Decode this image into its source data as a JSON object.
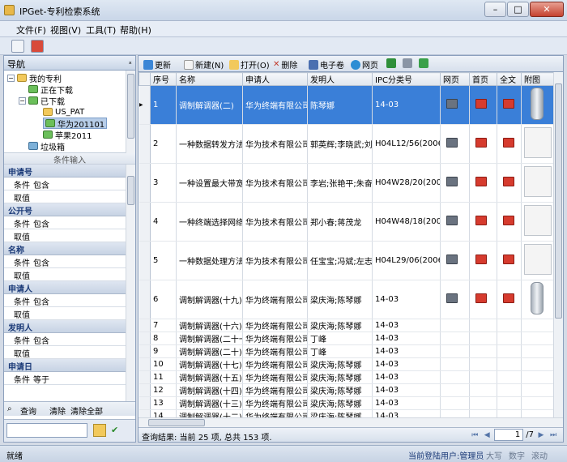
{
  "window": {
    "title": "IPGet-专利检索系统",
    "min": "–",
    "max": "□",
    "close": "✕"
  },
  "menu": [
    "文件(F)",
    "视图(V)",
    "工具(T)",
    "帮助(H)"
  ],
  "nav": {
    "title": "导航",
    "pin": "ₓ",
    "tree": [
      {
        "label": "我的专利"
      },
      {
        "label": "正在下载"
      },
      {
        "label": "已下载"
      },
      {
        "label": "US_PAT"
      },
      {
        "label": "华为201101"
      },
      {
        "label": "苹果2011"
      },
      {
        "label": "垃圾箱"
      }
    ],
    "cond_title": "条件输入",
    "sections": [
      {
        "name": "申请号",
        "cond_label": "条件",
        "cond": "包含",
        "val_label": "取值",
        "val": ""
      },
      {
        "name": "公开号",
        "cond_label": "条件",
        "cond": "包含",
        "val_label": "取值",
        "val": ""
      },
      {
        "name": "名称",
        "cond_label": "条件",
        "cond": "包含",
        "val_label": "取值",
        "val": ""
      },
      {
        "name": "申请人",
        "cond_label": "条件",
        "cond": "包含",
        "val_label": "取值",
        "val": ""
      },
      {
        "name": "发明人",
        "cond_label": "条件",
        "cond": "包含",
        "val_label": "取值",
        "val": ""
      },
      {
        "name": "申请日",
        "cond_label": "条件",
        "cond": "等于",
        "val_label": "",
        "val": ""
      }
    ],
    "query": "查询",
    "clear": "清除",
    "clear_all": "清除全部"
  },
  "toolbar": {
    "refresh": "更新",
    "new": "新建(N)",
    "open": "打开(O)",
    "delete": "删除",
    "ebook": "电子卷",
    "web": "网页"
  },
  "columns": [
    "序号",
    "名称",
    "申请人",
    "发明人",
    "IPC分类号",
    "网页",
    "首页",
    "全文",
    "附图"
  ],
  "rows": [
    {
      "no": "1",
      "name": "调制解调器(二)",
      "applicant": "华为终端有限公司",
      "inventor": "陈琴娜",
      "ipc": "14-03",
      "size": "big",
      "sel": true,
      "img": "cyl"
    },
    {
      "no": "2",
      "name": "一种数据转发方法",
      "applicant": "华为技术有限公司",
      "inventor": "郭英辉;李晓武;刘火",
      "ipc": "H04L12/56(2006",
      "size": "big",
      "img": "doc"
    },
    {
      "no": "3",
      "name": "一种设置最大带宽",
      "applicant": "华为技术有限公司",
      "inventor": "李岩;张艳平;朱奋勇",
      "ipc": "H04W28/20(200",
      "size": "big",
      "img": "doc"
    },
    {
      "no": "4",
      "name": "一种终端选择网络",
      "applicant": "华为技术有限公司",
      "inventor": "郑小春;蒋茂龙",
      "ipc": "H04W48/18(200",
      "size": "big",
      "img": "doc"
    },
    {
      "no": "5",
      "name": "一种数据处理方法",
      "applicant": "华为技术有限公司",
      "inventor": "任宝宝;冯斌;左志明",
      "ipc": "H04L29/06(2006",
      "size": "big",
      "img": "doc"
    },
    {
      "no": "6",
      "name": "调制解调器(十九)",
      "applicant": "华为终端有限公司",
      "inventor": "梁庆海;陈琴娜",
      "ipc": "14-03",
      "size": "big",
      "img": "cyl"
    },
    {
      "no": "7",
      "name": "调制解调器(十六)",
      "applicant": "华为终端有限公司",
      "inventor": "梁庆海;陈琴娜",
      "ipc": "14-03",
      "size": "small"
    },
    {
      "no": "8",
      "name": "调制解调器(二十一)",
      "applicant": "华为终端有限公司",
      "inventor": "丁峰",
      "ipc": "14-03",
      "size": "small"
    },
    {
      "no": "9",
      "name": "调制解调器(二十)",
      "applicant": "华为终端有限公司",
      "inventor": "丁峰",
      "ipc": "14-03",
      "size": "small"
    },
    {
      "no": "10",
      "name": "调制解调器(十七)",
      "applicant": "华为终端有限公司",
      "inventor": "梁庆海;陈琴娜",
      "ipc": "14-03",
      "size": "small"
    },
    {
      "no": "11",
      "name": "调制解调器(十五)",
      "applicant": "华为终端有限公司",
      "inventor": "梁庆海;陈琴娜",
      "ipc": "14-03",
      "size": "small"
    },
    {
      "no": "12",
      "name": "调制解调器(十四)",
      "applicant": "华为终端有限公司",
      "inventor": "梁庆海;陈琴娜",
      "ipc": "14-03",
      "size": "small"
    },
    {
      "no": "13",
      "name": "调制解调器(十三)",
      "applicant": "华为终端有限公司",
      "inventor": "梁庆海;陈琴娜",
      "ipc": "14-03",
      "size": "small"
    },
    {
      "no": "14",
      "name": "调制解调器(十二)",
      "applicant": "华为终端有限公司",
      "inventor": "梁庆海;陈琴娜",
      "ipc": "14-03",
      "size": "small"
    }
  ],
  "result": {
    "text": "查询结果: 当前 25 项, 总共 153 项.",
    "page": "1",
    "pages": "/7"
  },
  "status": {
    "ready": "就绪",
    "user": "当前登陆用户:管理员",
    "caps": "大写",
    "num": "数字",
    "scroll": "滚动"
  },
  "colors": {
    "accent": "#3a7fd8",
    "section": "#1b3a78"
  }
}
